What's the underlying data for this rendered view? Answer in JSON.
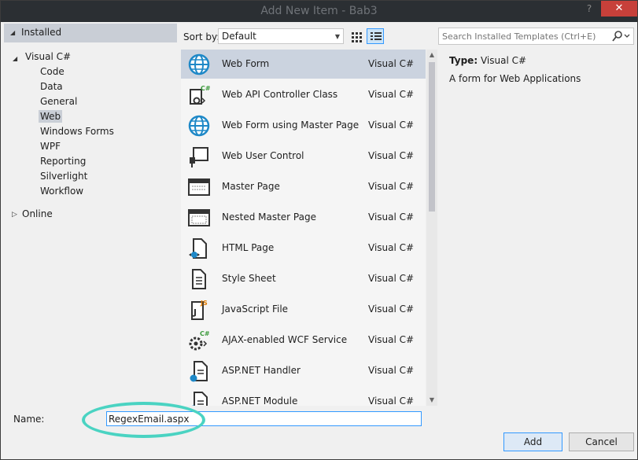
{
  "window": {
    "title": "Add New Item - Bab3",
    "help": "?",
    "close": "✕"
  },
  "tree": {
    "installed": "Installed",
    "visual_cs": "Visual C#",
    "children": [
      "Code",
      "Data",
      "General",
      "Web",
      "Windows Forms",
      "WPF",
      "Reporting",
      "Silverlight",
      "Workflow"
    ],
    "selected": "Web",
    "online": "Online"
  },
  "sort": {
    "label": "Sort by:",
    "value": "Default"
  },
  "search": {
    "placeholder": "Search Installed Templates (Ctrl+E)"
  },
  "items": [
    {
      "name": "Web Form",
      "lang": "Visual C#",
      "icon": "globe-icon",
      "selected": true
    },
    {
      "name": "Web API Controller Class",
      "lang": "Visual C#",
      "icon": "api-controller-icon"
    },
    {
      "name": "Web Form using Master Page",
      "lang": "Visual C#",
      "icon": "globe-icon"
    },
    {
      "name": "Web User Control",
      "lang": "Visual C#",
      "icon": "user-control-icon"
    },
    {
      "name": "Master Page",
      "lang": "Visual C#",
      "icon": "master-page-icon"
    },
    {
      "name": "Nested Master Page",
      "lang": "Visual C#",
      "icon": "nested-master-page-icon"
    },
    {
      "name": "HTML Page",
      "lang": "Visual C#",
      "icon": "html-page-icon"
    },
    {
      "name": "Style Sheet",
      "lang": "Visual C#",
      "icon": "style-sheet-icon"
    },
    {
      "name": "JavaScript File",
      "lang": "Visual C#",
      "icon": "javascript-file-icon"
    },
    {
      "name": "AJAX-enabled WCF Service",
      "lang": "Visual C#",
      "icon": "wcf-service-icon"
    },
    {
      "name": "ASP.NET Handler",
      "lang": "Visual C#",
      "icon": "handler-icon"
    },
    {
      "name": "ASP.NET Module",
      "lang": "Visual C#",
      "icon": "module-icon"
    }
  ],
  "details": {
    "type_label": "Type:",
    "type_value": "Visual C#",
    "description": "A form for Web Applications"
  },
  "name_field": {
    "label": "Name:",
    "value": "RegexEmail.aspx"
  },
  "buttons": {
    "add": "Add",
    "cancel": "Cancel"
  },
  "colors": {
    "selection": "#cbd3df",
    "accent": "#3399ff",
    "highlight_ring": "#4ad3c2",
    "close": "#c7403a"
  }
}
